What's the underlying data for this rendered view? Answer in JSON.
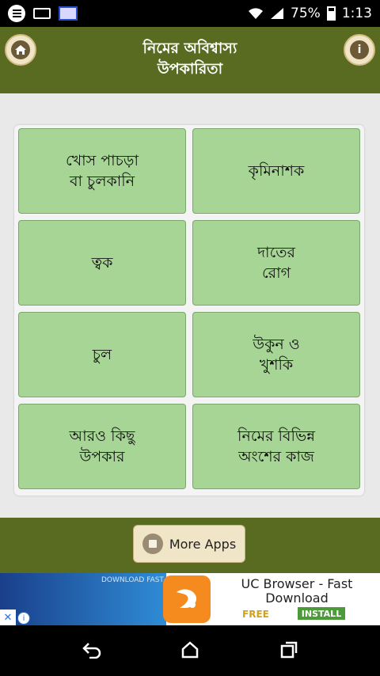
{
  "statusbar": {
    "battery": "75%",
    "time": "1:13"
  },
  "header": {
    "title": "নিমের অবিশ্বাস্য\nউপকারিতা",
    "info_glyph": "i"
  },
  "tiles": [
    "খোস পাচড়া\nবা চুলকানি",
    "কৃমিনাশক",
    "ত্বক",
    "দাতের\nরোগ",
    "চুল",
    "উকুন ও\nখুশকি",
    "আরও কিছু\nউপকার",
    "নিমের বিভিন্ন\nঅংশের কাজ"
  ],
  "bottom": {
    "more_apps_label": "More Apps"
  },
  "ad": {
    "image_text": "DOWNLOAD FAST",
    "title": "UC Browser - Fast Download",
    "price": "FREE",
    "install_label": "INSTALL",
    "close_glyph": "✕",
    "info_glyph": "i"
  },
  "colors": {
    "header": "#586b21",
    "tile": "#a7d595",
    "button": "#f1e5c7"
  }
}
